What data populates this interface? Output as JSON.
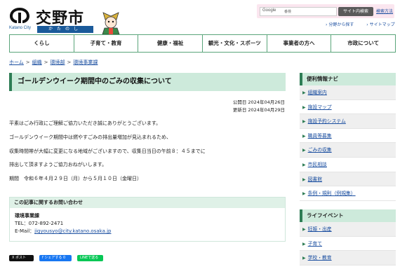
{
  "header": {
    "logo_title": "交野市",
    "logo_city": "Katano City",
    "logo_kana": "かたのし"
  },
  "utility": {
    "search_brand": "Google",
    "search_value": "番検",
    "search_button": "サイト内検索",
    "search_settings": "検索方法",
    "links": [
      "分野から探す",
      "サイトマップ"
    ]
  },
  "nav": {
    "items": [
      "くらし",
      "子育て・教育",
      "健康・福祉",
      "観光・文化・スポーツ",
      "事業者の方へ",
      "市政について"
    ]
  },
  "breadcrumb": {
    "items": [
      "ホーム",
      "組織",
      "環境部",
      "環境事業課"
    ]
  },
  "main": {
    "title": "ゴールデンウイーク期間中のごみの収集について",
    "published": "公開日 2024年04月26日",
    "updated": "更新日 2024年04月29日",
    "paragraphs": [
      "平素はごみ行政にご理解ご協力いただき誠にありがとうございます。",
      "ゴールデンウイーク期間中は燃やすごみの排出量増加が見込まれるため、",
      "収集時間帯が大幅に変更になる地域がございますので、収集日当日の午前８：４５までに",
      "排出して頂ますようご協力おねがいします。",
      "期間　令和６年４月２９日（月）から５月１０日（金曜日）"
    ]
  },
  "contact": {
    "heading": "この記事に関するお問い合わせ",
    "dept": "環境事業課",
    "tel": "TEL：072-892-2471",
    "email_label": "E-Mail：",
    "email": "jigyousyo@city.katano.osaka.jp"
  },
  "share": {
    "x": "X ポスト",
    "facebook": "f シェアする 0",
    "line": "LINEで送る"
  },
  "sidebar": {
    "nav_title": "便利情報ナビ",
    "nav_items": [
      "組織案内",
      "施設マップ",
      "施設予約システム",
      "職員等募集",
      "ごみの収集",
      "市民相談",
      "図書館",
      "条例・規則（例規集）"
    ],
    "life_title": "ライフイベント",
    "life_items": [
      "妊娠・出産",
      "子育て",
      "学校・教育"
    ]
  },
  "colors": {
    "accent_green": "#2e7d55",
    "light_green": "#cdeadb",
    "link_blue": "#1a4ea0",
    "utility_pink": "#fbe6ef"
  }
}
